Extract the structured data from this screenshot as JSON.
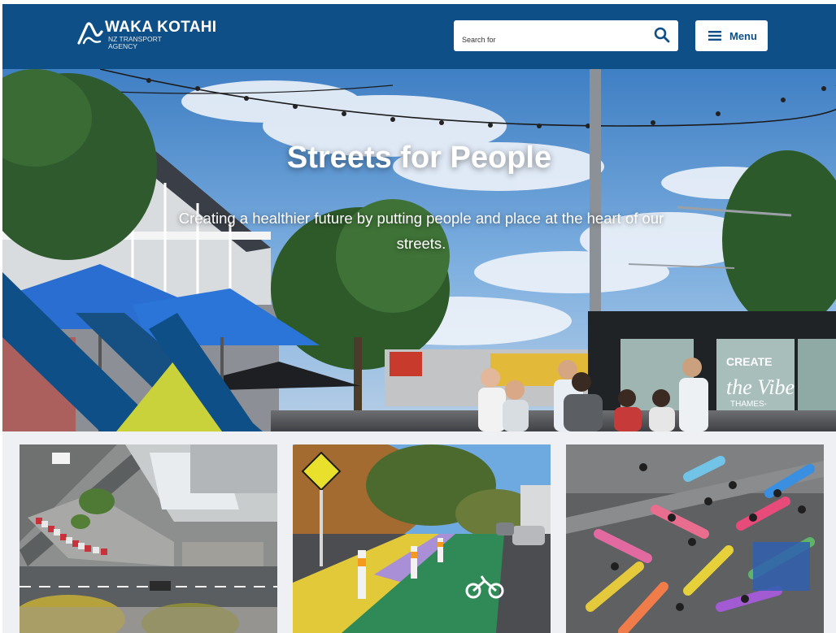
{
  "header": {
    "logo": {
      "name": "WAKA KOTAHI",
      "sub_line1": "NZ TRANSPORT",
      "sub_line2": "AGENCY"
    },
    "search": {
      "placeholder": "Search for",
      "icon": "search-icon"
    },
    "menu": {
      "label": "Menu",
      "icon": "hamburger-icon"
    }
  },
  "hero": {
    "title": "Streets for People",
    "subtitle": "Creating a healthier future by putting people and place at the heart of our streets.",
    "container_text_line1": "CREATE",
    "container_text_line2": "the Vibe",
    "container_text_line3": "THAMES-"
  },
  "cards": [
    {
      "image": "aerial-street-intersection-photo"
    },
    {
      "image": "painted-cycleway-photo"
    },
    {
      "image": "pencil-street-art-photo"
    }
  ],
  "colors": {
    "brand_blue": "#0d4f86",
    "accent_yellow": "#c9d23b",
    "white": "#ffffff"
  }
}
